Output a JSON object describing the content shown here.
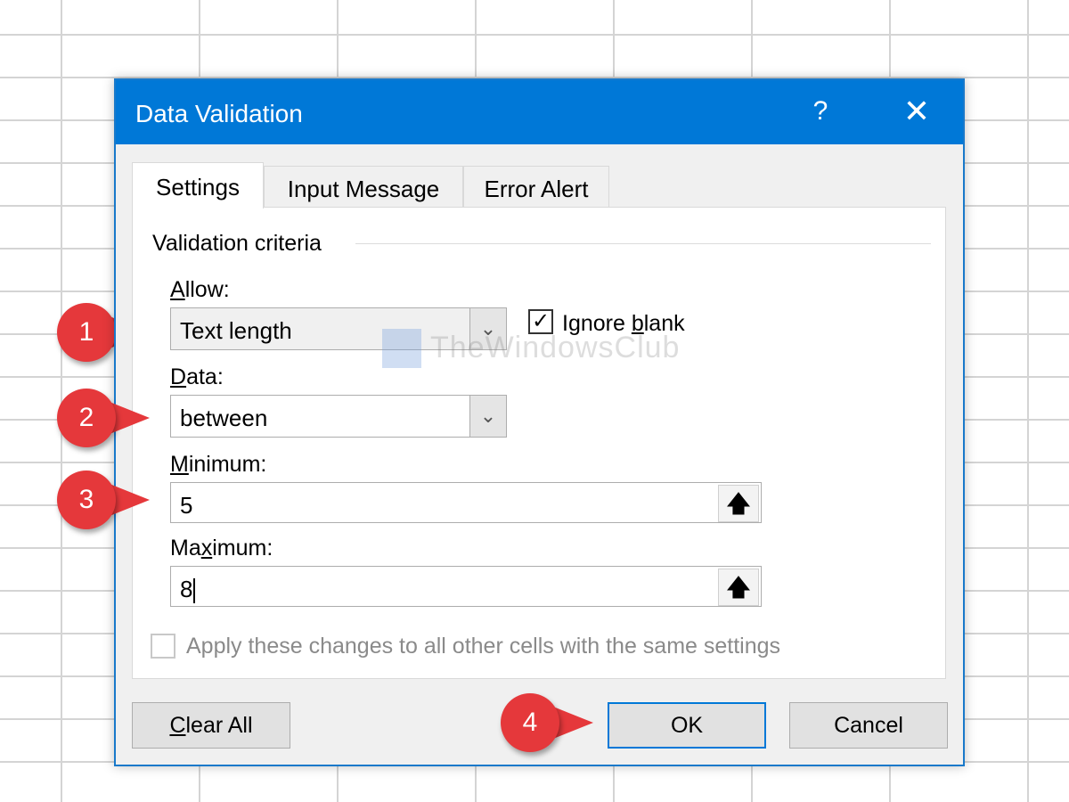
{
  "dialog": {
    "title": "Data Validation",
    "help_label": "?",
    "close_label": "✕"
  },
  "tabs": [
    {
      "label": "Settings",
      "active": true
    },
    {
      "label": "Input Message",
      "active": false
    },
    {
      "label": "Error Alert",
      "active": false
    }
  ],
  "settings": {
    "group_label": "Validation criteria",
    "allow": {
      "label_prefix": "",
      "label_key": "A",
      "label_rest": "llow:",
      "value": "Text length"
    },
    "ignore_blank": {
      "label_pre": "Ignore ",
      "label_key": "b",
      "label_post": "lank",
      "checked": true
    },
    "data": {
      "label_key": "D",
      "label_rest": "ata:",
      "value": "between"
    },
    "minimum": {
      "label_key": "M",
      "label_rest": "inimum:",
      "value": "5"
    },
    "maximum": {
      "label_pre": "Ma",
      "label_key": "x",
      "label_post": "imum:",
      "value": "8"
    },
    "apply_all": {
      "label": "Apply these changes to all other cells with the same settings",
      "checked": false
    }
  },
  "buttons": {
    "clear_all_key": "C",
    "clear_all_rest": "lear All",
    "ok": "OK",
    "cancel": "Cancel"
  },
  "callouts": [
    "1",
    "2",
    "3",
    "4"
  ],
  "watermark": "TheWindowsClub",
  "colors": {
    "titlebar": "#0078d7",
    "callout": "#e5383b"
  }
}
